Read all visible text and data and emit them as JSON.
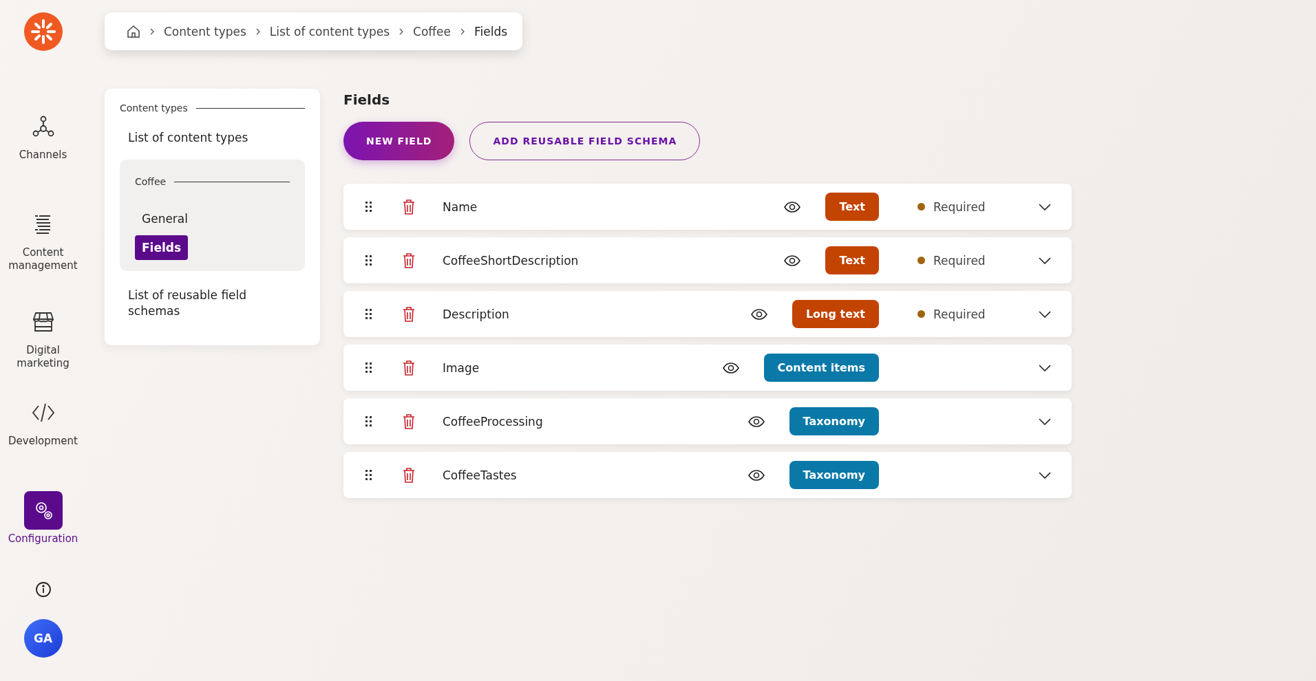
{
  "nav": {
    "items": [
      {
        "label": "Channels",
        "selected": false
      },
      {
        "label": "Content management",
        "selected": false
      },
      {
        "label": "Digital marketing",
        "selected": false
      },
      {
        "label": "Development",
        "selected": false
      },
      {
        "label": "Configuration",
        "selected": true
      }
    ],
    "avatar": "GA"
  },
  "breadcrumb": [
    "Content types",
    "List of content types",
    "Coffee",
    "Fields"
  ],
  "submenu": {
    "heading": "Content types",
    "items": [
      {
        "kind": "link",
        "label": "List of content types"
      },
      {
        "kind": "group",
        "heading": "Coffee",
        "children": [
          {
            "label": "General",
            "selected": false
          },
          {
            "label": "Fields",
            "selected": true
          }
        ]
      },
      {
        "kind": "link",
        "label": "List of reusable field schemas"
      }
    ]
  },
  "page": {
    "title": "Fields",
    "buttons": [
      {
        "kind": "primary",
        "label": "NEW FIELD"
      },
      {
        "kind": "outline",
        "label": "ADD REUSABLE FIELD SCHEMA"
      }
    ]
  },
  "fields": [
    {
      "name": "Name",
      "type": "Text",
      "color": "#c34300",
      "required": "Required"
    },
    {
      "name": "CoffeeShortDescription",
      "type": "Text",
      "color": "#c34300",
      "required": "Required"
    },
    {
      "name": "Description",
      "type": "Long text",
      "color": "#c34300",
      "required": "Required"
    },
    {
      "name": "Image",
      "type": "Content items",
      "color": "#0a79a8"
    },
    {
      "name": "CoffeeProcessing",
      "type": "Taxonomy",
      "color": "#0a79a8"
    },
    {
      "name": "CoffeeTastes",
      "type": "Taxonomy",
      "color": "#0a79a8"
    }
  ]
}
